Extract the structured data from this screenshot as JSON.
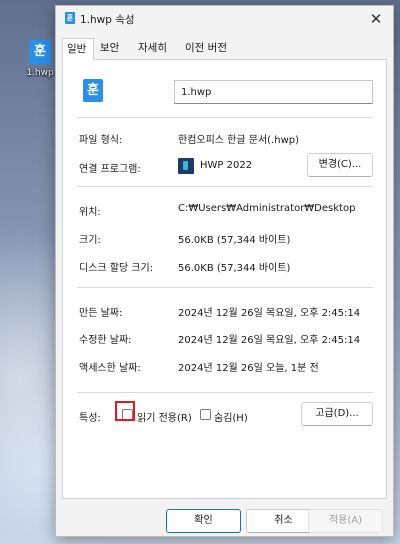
{
  "desktop": {
    "icon_glyph": "훈",
    "file_label": "1.hwp"
  },
  "dialog": {
    "title": "1.hwp 속성",
    "title_icon_glyph": "훈",
    "close_glyph": "✕"
  },
  "tabs": [
    {
      "label": "일반",
      "active": true
    },
    {
      "label": "보안",
      "active": false
    },
    {
      "label": "자세히",
      "active": false
    },
    {
      "label": "이전 버전",
      "active": false
    }
  ],
  "general": {
    "file_icon_glyph": "훈",
    "file_name": "1.hwp",
    "file_type_label": "파일 형식:",
    "file_type_value": "한컴오피스 한글 문서(.hwp)",
    "open_with_label": "연결 프로그램:",
    "open_with_value": "HWP 2022",
    "change_button": "변경(C)...",
    "location_label": "위치:",
    "location_value": "C:₩Users₩Administrator₩Desktop",
    "size_label": "크기:",
    "size_value": "56.0KB (57,344 바이트)",
    "size_on_disk_label": "디스크 할당 크기:",
    "size_on_disk_value": "56.0KB (57,344 바이트)",
    "created_label": "만든 날짜:",
    "created_value": "2024년 12월 26일 목요일, 오후 2:45:14",
    "modified_label": "수정한 날짜:",
    "modified_value": "2024년 12월 26일 목요일, 오후 2:45:14",
    "accessed_label": "액세스한 날짜:",
    "accessed_value": "2024년 12월 26일 오늘, 1분 전",
    "attributes_label": "특성:",
    "readonly_label": "읽기 전용(R)",
    "readonly_checked": false,
    "hidden_label": "숨김(H)",
    "hidden_checked": false,
    "advanced_button": "고급(D)..."
  },
  "footer": {
    "ok": "확인",
    "cancel": "취소",
    "apply": "적용(A)"
  },
  "colors": {
    "hwp_brand": "#2a8fe6",
    "highlight": "#e8191d",
    "ok_border": "#1e6fbf"
  }
}
